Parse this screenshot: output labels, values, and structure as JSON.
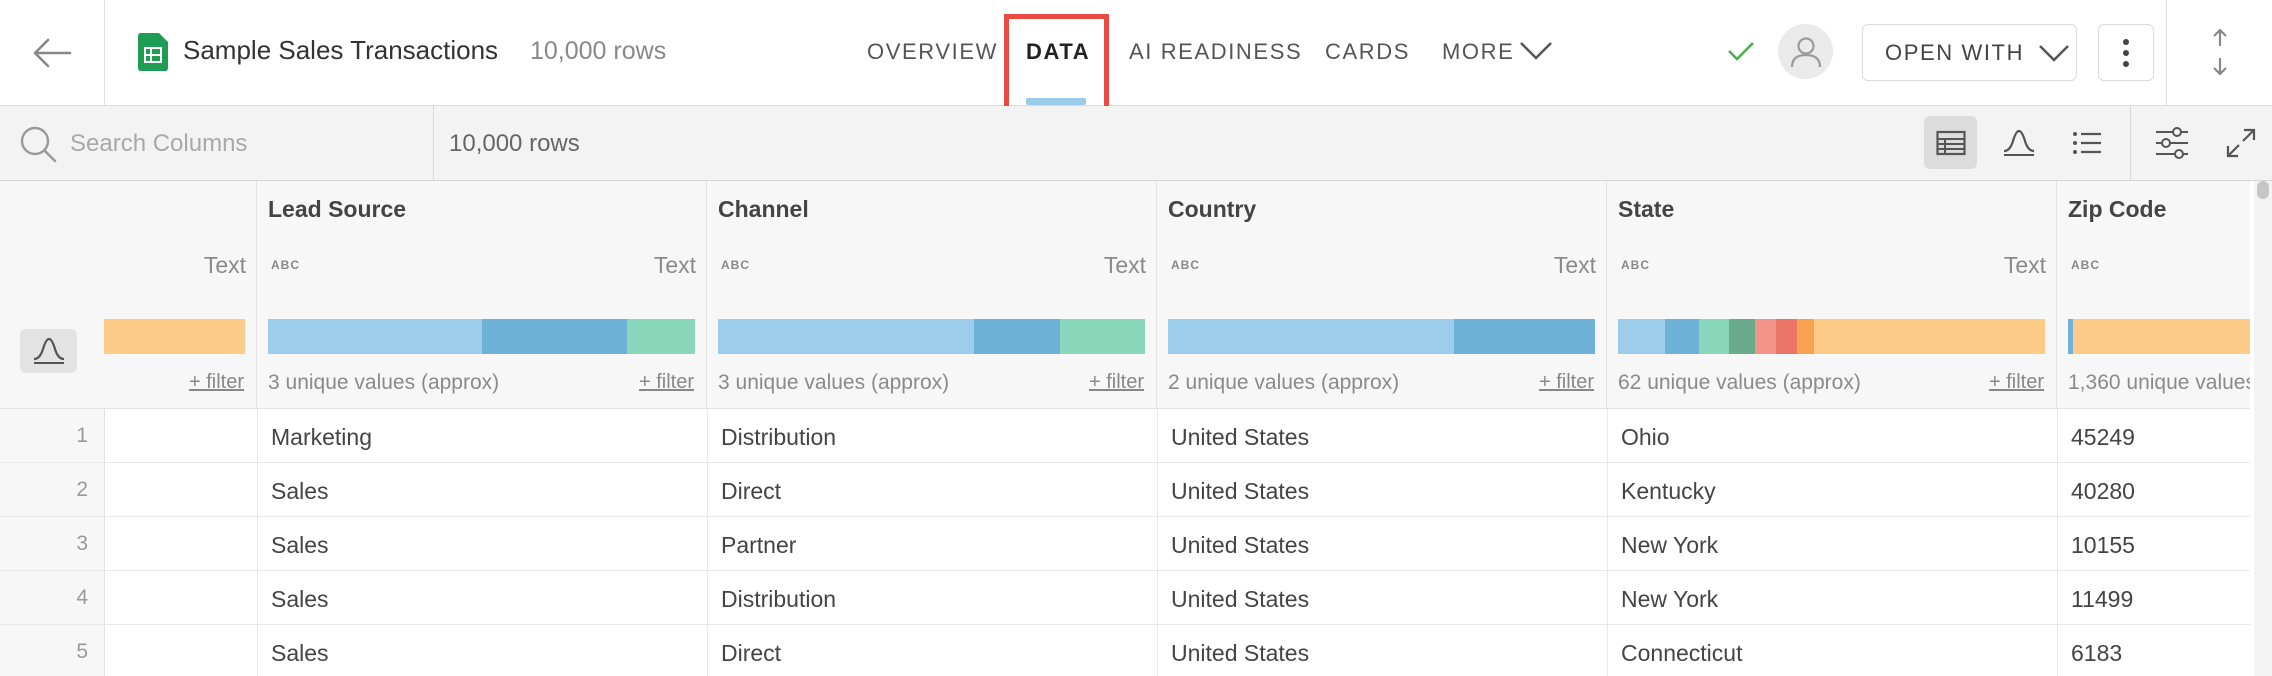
{
  "header": {
    "title": "Sample Sales Transactions",
    "row_count": "10,000 rows",
    "tabs": [
      {
        "label": "OVERVIEW"
      },
      {
        "label": "DATA"
      },
      {
        "label": "AI READINESS"
      },
      {
        "label": "CARDS"
      },
      {
        "label": "MORE"
      }
    ],
    "open_with": "OPEN WITH"
  },
  "toolbar": {
    "search_placeholder": "Search Columns",
    "row_count": "10,000 rows"
  },
  "columns": [
    {
      "name": "",
      "abc": "",
      "type": "Text",
      "unique": "",
      "filter": "+ filter"
    },
    {
      "name": "Lead Source",
      "abc": "ABC",
      "type": "Text",
      "unique": "3 unique values (approx)",
      "filter": "+ filter"
    },
    {
      "name": "Channel",
      "abc": "ABC",
      "type": "Text",
      "unique": "3 unique values (approx)",
      "filter": "+ filter"
    },
    {
      "name": "Country",
      "abc": "ABC",
      "type": "Text",
      "unique": "2 unique values (approx)",
      "filter": "+ filter"
    },
    {
      "name": "State",
      "abc": "ABC",
      "type": "Text",
      "unique": "62 unique values (approx)",
      "filter": "+ filter"
    },
    {
      "name": "Zip Code",
      "abc": "ABC",
      "type": "",
      "unique": "1,360 unique values",
      "filter": ""
    }
  ],
  "colors": {
    "blue_light": "#9ccdea",
    "blue": "#6fb2d8",
    "teal": "#8ad6bb",
    "orange_light": "#fccc88",
    "highlight_red": "#e94b42",
    "check_green": "#4caf50"
  },
  "rows": [
    {
      "num": "1",
      "cells": [
        "",
        "Marketing",
        "Distribution",
        "United States",
        "Ohio",
        "45249"
      ]
    },
    {
      "num": "2",
      "cells": [
        "",
        "Sales",
        "Direct",
        "United States",
        "Kentucky",
        "40280"
      ]
    },
    {
      "num": "3",
      "cells": [
        "",
        "Sales",
        "Partner",
        "United States",
        "New York",
        "10155"
      ]
    },
    {
      "num": "4",
      "cells": [
        "",
        "Sales",
        "Distribution",
        "United States",
        "New York",
        "11499"
      ]
    },
    {
      "num": "5",
      "cells": [
        "",
        "Sales",
        "Direct",
        "United States",
        "Connecticut",
        "6183"
      ]
    }
  ]
}
